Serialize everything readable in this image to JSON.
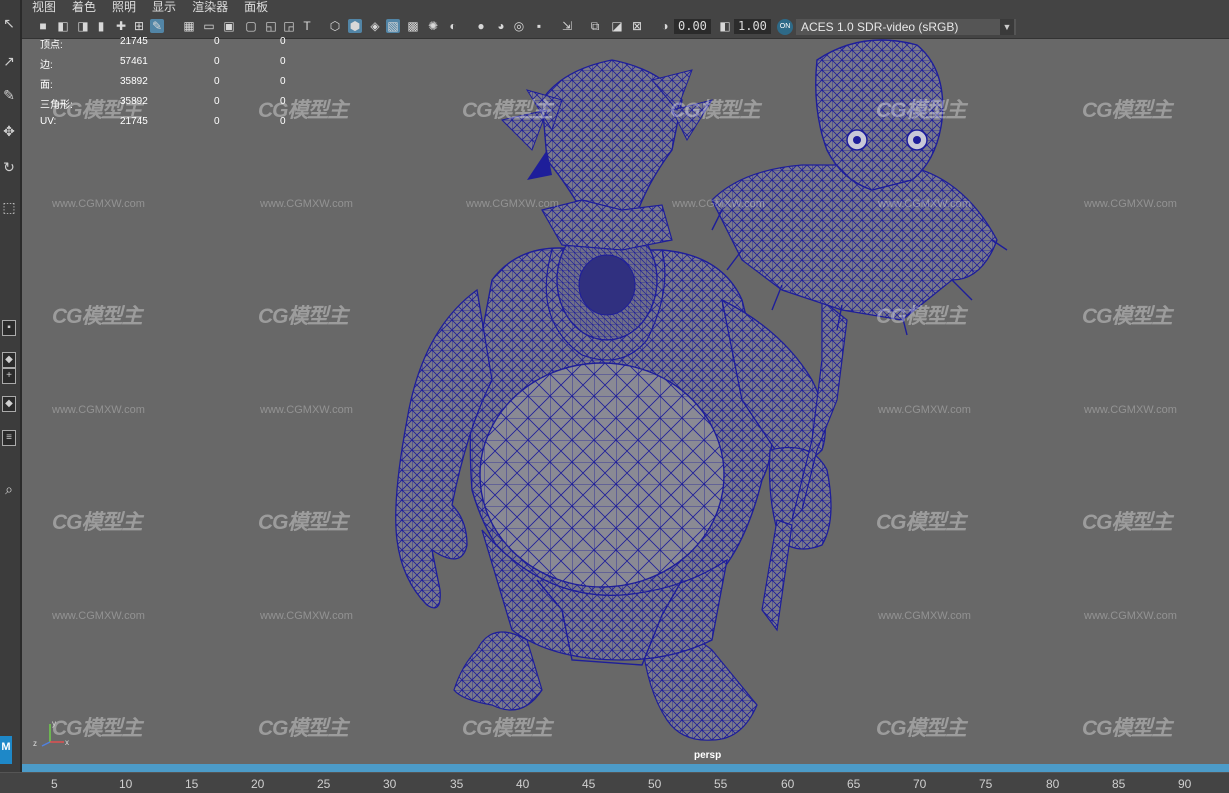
{
  "menu": [
    "视图",
    "着色",
    "照明",
    "显示",
    "渲染器",
    "面板"
  ],
  "toolbar": {
    "exposure_value": "0.00",
    "gamma_value": "1.00",
    "color_space": "ACES 1.0 SDR-video (sRGB)",
    "color_mgmt_badge": "ON",
    "icons": [
      "camera-icon",
      "camera-attr-icon",
      "bookmark-icon",
      "image-plane-icon",
      "grid-icon",
      "film-gate-icon",
      "resolution-gate-icon",
      "gate-mask-icon",
      "field-chart-icon",
      "safe-action-icon",
      "safe-title-icon",
      "wireframe-icon",
      "smooth-shade-icon",
      "wireframe-on-shaded-icon",
      "xray-icon",
      "textured-icon",
      "light-icon",
      "shadow-icon",
      "ssao-icon",
      "motion-blur-icon",
      "aa-icon",
      "depth-of-field-icon",
      "isolate-select-icon",
      "xray-joints-icon",
      "backface-icon",
      "xray-components-icon",
      "exposure-icon",
      "gamma-icon",
      "view-transform-icon"
    ]
  },
  "hud": {
    "rows": [
      {
        "label": "顶点:",
        "v1": "21745",
        "v2": "0",
        "v3": "0"
      },
      {
        "label": "边:",
        "v1": "57461",
        "v2": "0",
        "v3": "0"
      },
      {
        "label": "面:",
        "v1": "35892",
        "v2": "0",
        "v3": "0"
      },
      {
        "label": "三角形:",
        "v1": "35892",
        "v2": "0",
        "v3": "0"
      },
      {
        "label": "UV:",
        "v1": "21745",
        "v2": "0",
        "v3": "0"
      }
    ]
  },
  "viewport": {
    "camera": "persp",
    "watermark_logo": "CG模型主",
    "watermark_url": "www.CGMXW.com",
    "wireframe_color": "#1e1e9a",
    "background_color": "#686868"
  },
  "axis": {
    "x": "x",
    "y": "y",
    "z": "z"
  },
  "toolbox": {
    "logo": "M"
  },
  "timeline": {
    "ticks": [
      "5",
      "10",
      "15",
      "20",
      "25",
      "30",
      "35",
      "40",
      "45",
      "50",
      "55",
      "60",
      "65",
      "70",
      "75",
      "80",
      "85",
      "90"
    ],
    "bar_color": "#4c9bc8"
  }
}
